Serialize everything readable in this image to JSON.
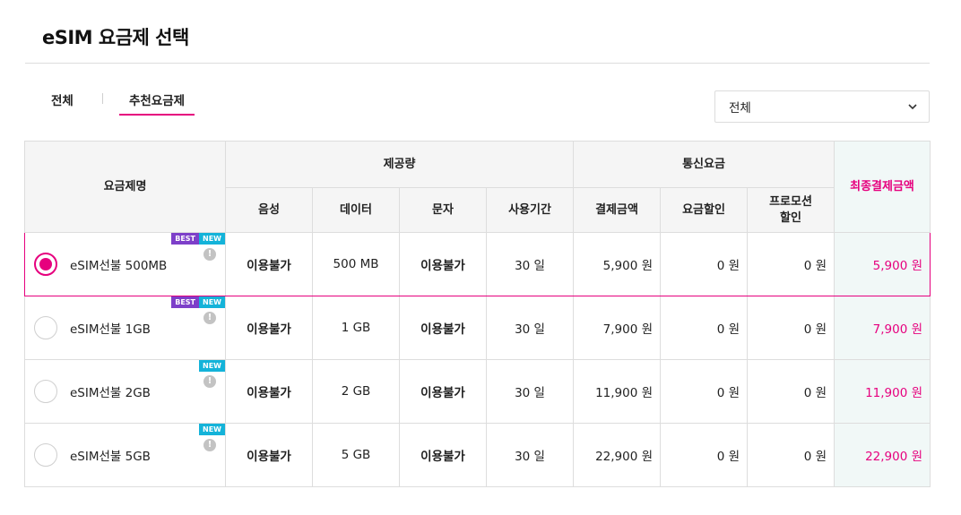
{
  "page": {
    "title": "eSIM 요금제 선택"
  },
  "tabs": [
    {
      "label": "전체"
    },
    {
      "label": "추천요금제",
      "active": true
    }
  ],
  "filter": {
    "selected": "전체"
  },
  "table": {
    "headers": {
      "name": "요금제명",
      "provided": "제공량",
      "fee_group": "통신요금",
      "final": "최종결제금액",
      "voice": "음성",
      "data": "데이터",
      "sms": "문자",
      "period": "사용기간",
      "payment": "결제금액",
      "discount": "요금할인",
      "promo_discount": "프로모션\n할인"
    },
    "rows": [
      {
        "badges": [
          "BEST",
          "NEW"
        ],
        "info": "!",
        "name": "eSIM선불 500MB",
        "voice": "이용불가",
        "data": "500 MB",
        "sms": "이용불가",
        "period": "30 일",
        "payment": "5,900 원",
        "discount": "0 원",
        "promo": "0 원",
        "final": "5,900 원",
        "selected": true
      },
      {
        "badges": [
          "BEST",
          "NEW"
        ],
        "info": "!",
        "name": "eSIM선불 1GB",
        "voice": "이용불가",
        "data": "1 GB",
        "sms": "이용불가",
        "period": "30 일",
        "payment": "7,900 원",
        "discount": "0 원",
        "promo": "0 원",
        "final": "7,900 원",
        "selected": false
      },
      {
        "badges": [
          "NEW"
        ],
        "info": "!",
        "name": "eSIM선불 2GB",
        "voice": "이용불가",
        "data": "2 GB",
        "sms": "이용불가",
        "period": "30 일",
        "payment": "11,900 원",
        "discount": "0 원",
        "promo": "0 원",
        "final": "11,900 원",
        "selected": false
      },
      {
        "badges": [
          "NEW"
        ],
        "info": "!",
        "name": "eSIM선불 5GB",
        "voice": "이용불가",
        "data": "5 GB",
        "sms": "이용불가",
        "period": "30 일",
        "payment": "22,900 원",
        "discount": "0 원",
        "promo": "0 원",
        "final": "22,900 원",
        "selected": false
      }
    ]
  },
  "colors": {
    "accent": "#e6007e",
    "best_badge": "#7d3fc9",
    "new_badge": "#14b3d9",
    "final_bg": "#f1f8f7"
  },
  "icons": {
    "select": "chevron-down-icon",
    "info": "info-icon",
    "radio": "radio-button"
  }
}
